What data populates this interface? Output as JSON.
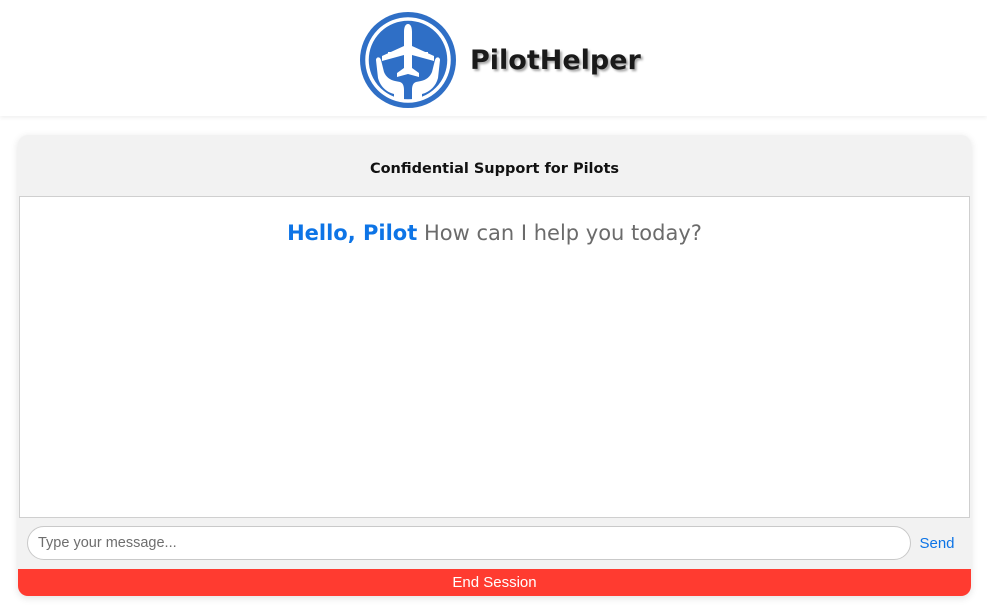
{
  "brand": {
    "name": "PilotHelper",
    "logo_icon": "airplane-in-hands-icon",
    "accent_color": "#2f6fc6"
  },
  "card": {
    "title": "Confidential Support for Pilots"
  },
  "chat": {
    "greeting_highlight": "Hello, Pilot",
    "greeting_text": "How can I help you today?"
  },
  "composer": {
    "placeholder": "Type your message...",
    "value": "",
    "send_label": "Send"
  },
  "session": {
    "end_label": "End Session",
    "end_color": "#ff3b30"
  },
  "colors": {
    "link_blue": "#0d74e6",
    "card_background": "#f2f2f2"
  }
}
